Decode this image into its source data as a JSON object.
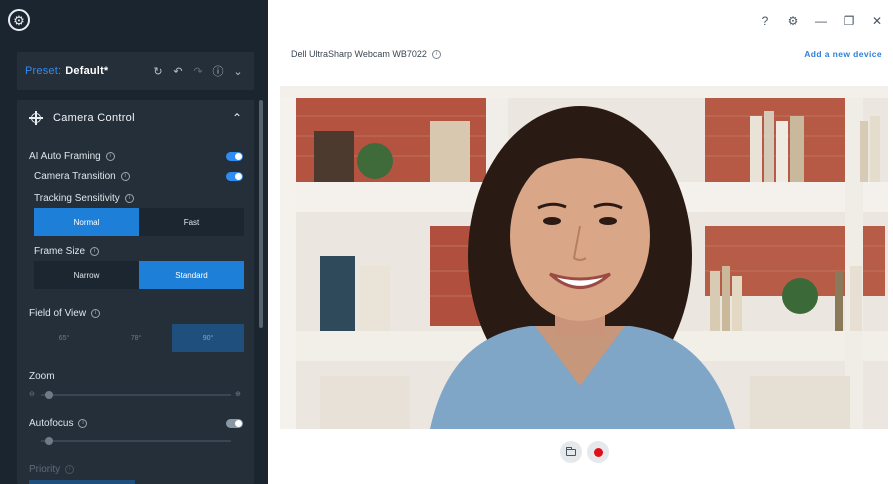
{
  "sidebar": {
    "preset": {
      "label": "Preset:",
      "value": "Default*"
    },
    "camera_control": {
      "title": "Camera Control",
      "ai_auto_framing": {
        "label": "AI Auto Framing",
        "enabled": true
      },
      "camera_transition": {
        "label": "Camera Transition",
        "enabled": true
      },
      "tracking_sensitivity": {
        "label": "Tracking Sensitivity",
        "options": [
          "Normal",
          "Fast"
        ],
        "selected": "Normal"
      },
      "frame_size": {
        "label": "Frame Size",
        "options": [
          "Narrow",
          "Standard"
        ],
        "selected": "Standard"
      },
      "field_of_view": {
        "label": "Field of View",
        "options": [
          "65°",
          "78°",
          "90°"
        ],
        "selected": "90°"
      },
      "zoom": {
        "label": "Zoom"
      },
      "autofocus": {
        "label": "Autofocus",
        "enabled": true
      },
      "priority": {
        "label": "Priority"
      }
    }
  },
  "main": {
    "device_name": "Dell UltraSharp Webcam WB7022",
    "add_device_label": "Add a new device"
  },
  "colors": {
    "sidebar_bg": "#1b2530",
    "panel_bg": "#242f3a",
    "accent": "#2f8cf2",
    "record": "#e0101a"
  },
  "icons": {
    "app": "gear-camera-icon",
    "help": "help-icon",
    "settings": "gear-icon",
    "minimize": "minimize-icon",
    "restore": "restore-icon",
    "close": "close-icon",
    "folder": "folder-icon",
    "record": "record-icon"
  }
}
